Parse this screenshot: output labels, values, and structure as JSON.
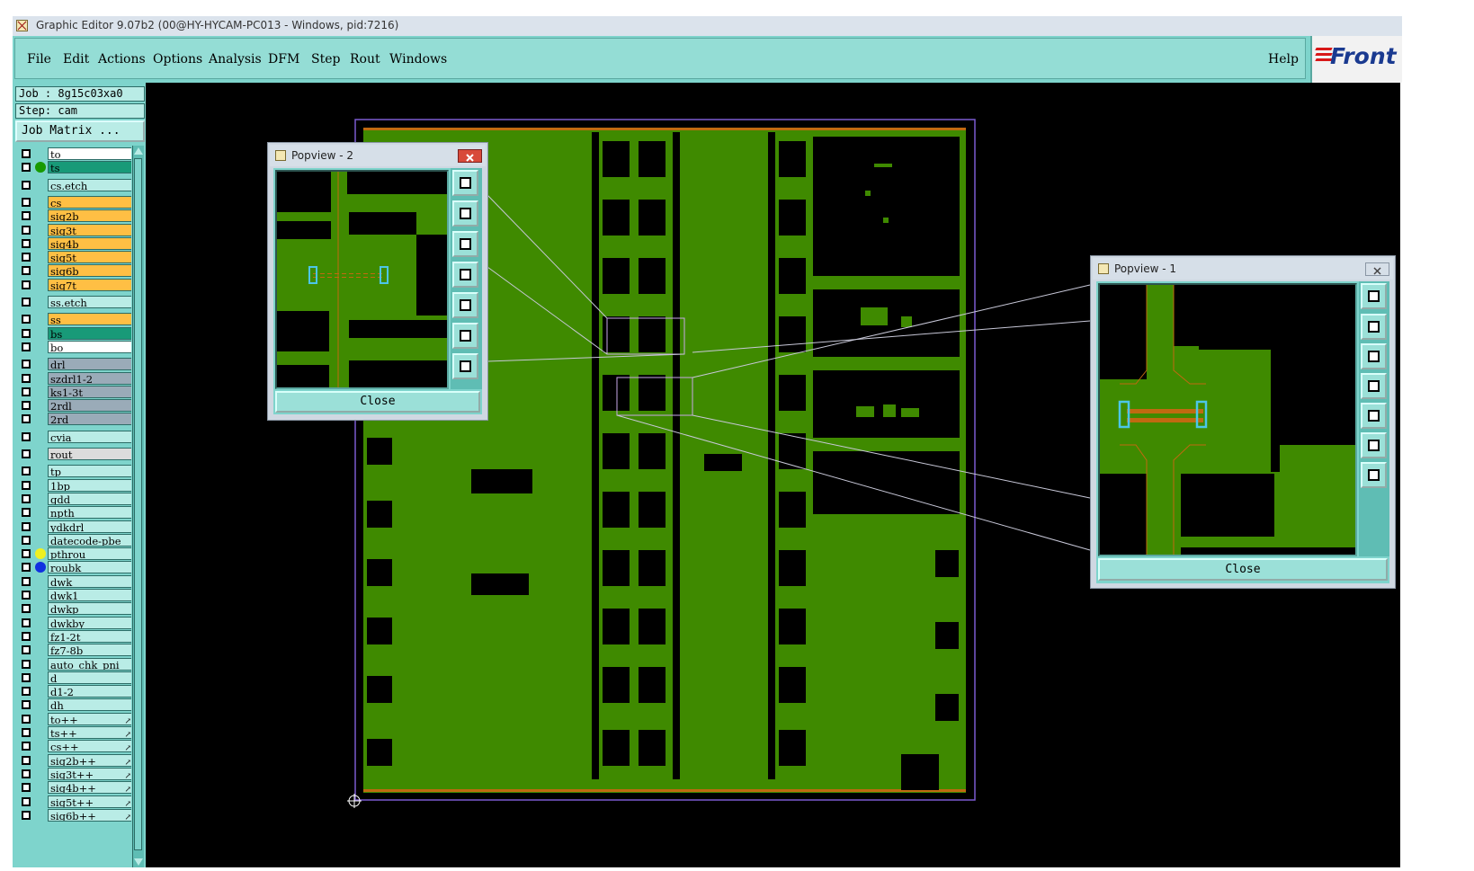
{
  "window": {
    "title": "Graphic Editor 9.07b2 (00@HY-HYCAM-PC013 - Windows, pid:7216)"
  },
  "menu": {
    "items": [
      "File",
      "Edit",
      "Actions",
      "Options",
      "Analysis",
      "DFM",
      "Step",
      "Rout",
      "Windows"
    ],
    "help": "Help",
    "logo_text": "Front"
  },
  "panel": {
    "job_label": "Job : 8g15c03xa0",
    "step_label": "Step: cam",
    "job_matrix": "Job Matrix ..."
  },
  "layers": [
    {
      "name": "to",
      "bg": "#ffffff",
      "dot": ""
    },
    {
      "name": "ts",
      "bg": "#189a78",
      "dot": "#189a00"
    },
    {
      "name": "cs.etch",
      "bg": "#b9ece6",
      "dot": ""
    },
    {
      "name": "cs",
      "bg": "#ffbf44",
      "dot": ""
    },
    {
      "name": "sig2b",
      "bg": "#ffbf44",
      "dot": ""
    },
    {
      "name": "sig3t",
      "bg": "#ffbf44",
      "dot": ""
    },
    {
      "name": "sig4b",
      "bg": "#ffbf44",
      "dot": ""
    },
    {
      "name": "sig5t",
      "bg": "#ffbf44",
      "dot": ""
    },
    {
      "name": "sig6b",
      "bg": "#ffbf44",
      "dot": ""
    },
    {
      "name": "sig7t",
      "bg": "#ffbf44",
      "dot": ""
    },
    {
      "name": "ss.etch",
      "bg": "#b9ece6",
      "dot": ""
    },
    {
      "name": "ss",
      "bg": "#ffbf44",
      "dot": ""
    },
    {
      "name": "bs",
      "bg": "#189a78",
      "dot": ""
    },
    {
      "name": "bo",
      "bg": "#ffffff",
      "dot": ""
    },
    {
      "name": "drl",
      "bg": "#9aabb8",
      "dot": ""
    },
    {
      "name": "szdrl1-2",
      "bg": "#9aabb8",
      "dot": ""
    },
    {
      "name": "ks1-3t",
      "bg": "#9aabb8",
      "dot": ""
    },
    {
      "name": "2rdl",
      "bg": "#9aabb8",
      "dot": ""
    },
    {
      "name": "2rd",
      "bg": "#9aabb8",
      "dot": ""
    },
    {
      "name": "cvia",
      "bg": "#b9ece6",
      "dot": ""
    },
    {
      "name": "rout",
      "bg": "#dcdcdc",
      "dot": ""
    },
    {
      "name": "tp",
      "bg": "#b9ece6",
      "dot": ""
    },
    {
      "name": "1bp",
      "bg": "#b9ece6",
      "dot": ""
    },
    {
      "name": "gdd",
      "bg": "#b9ece6",
      "dot": ""
    },
    {
      "name": "npth",
      "bg": "#b9ece6",
      "dot": ""
    },
    {
      "name": "ydkdrl",
      "bg": "#b9ece6",
      "dot": ""
    },
    {
      "name": "datecode-pbe",
      "bg": "#b9ece6",
      "dot": ""
    },
    {
      "name": "pthrou",
      "bg": "#b9ece6",
      "dot": "#f0f020"
    },
    {
      "name": "roubk",
      "bg": "#b9ece6",
      "dot": "#1030e0"
    },
    {
      "name": "dwk",
      "bg": "#b9ece6",
      "dot": ""
    },
    {
      "name": "dwk1",
      "bg": "#b9ece6",
      "dot": ""
    },
    {
      "name": "dwkp",
      "bg": "#b9ece6",
      "dot": ""
    },
    {
      "name": "dwkby",
      "bg": "#b9ece6",
      "dot": ""
    },
    {
      "name": "fz1-2t",
      "bg": "#b9ece6",
      "dot": ""
    },
    {
      "name": "fz7-8b",
      "bg": "#b9ece6",
      "dot": ""
    },
    {
      "name": "auto_chk_pni",
      "bg": "#b9ece6",
      "dot": ""
    },
    {
      "name": "d",
      "bg": "#b9ece6",
      "dot": ""
    },
    {
      "name": "d1-2",
      "bg": "#b9ece6",
      "dot": ""
    },
    {
      "name": "dh",
      "bg": "#b9ece6",
      "dot": ""
    },
    {
      "name": "to++",
      "bg": "#b9ece6",
      "dot": "",
      "arrow": true
    },
    {
      "name": "ts++",
      "bg": "#b9ece6",
      "dot": "",
      "arrow": true
    },
    {
      "name": "cs++",
      "bg": "#b9ece6",
      "dot": "",
      "arrow": true
    },
    {
      "name": "sig2b++",
      "bg": "#b9ece6",
      "dot": "",
      "arrow": true
    },
    {
      "name": "sig3t++",
      "bg": "#b9ece6",
      "dot": "",
      "arrow": true
    },
    {
      "name": "sig4b++",
      "bg": "#b9ece6",
      "dot": "",
      "arrow": true
    },
    {
      "name": "sig5t++",
      "bg": "#b9ece6",
      "dot": "",
      "arrow": true
    },
    {
      "name": "sig6b++",
      "bg": "#b9ece6",
      "dot": "",
      "arrow": true
    }
  ],
  "popview2": {
    "title": "Popview - 2",
    "close": "Close"
  },
  "popview1": {
    "title": "Popview - 1",
    "close": "Close"
  },
  "colors": {
    "board": "#3f8a00",
    "canvas": "#000000",
    "panel": "#7ed4cc",
    "selection": "#c8a8e8"
  }
}
